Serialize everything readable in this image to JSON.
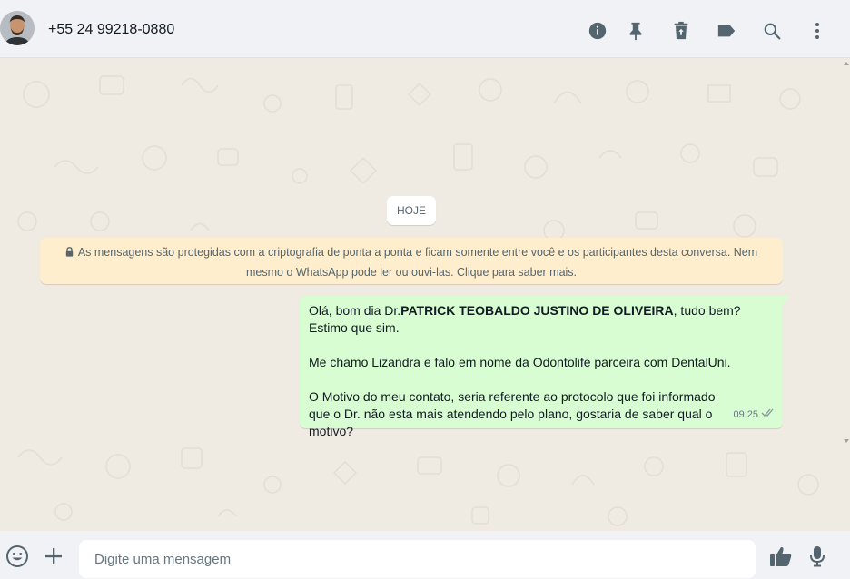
{
  "header": {
    "contact_name": "+55 24 99218-0880"
  },
  "chat": {
    "date_chip": "HOJE",
    "encryption_notice": "As mensagens são protegidas com a criptografia de ponta a ponta e ficam somente entre você e os participantes desta conversa. Nem mesmo o WhatsApp pode ler ou ouvi-las. Clique para saber mais.",
    "message": {
      "line1_prefix": "Olá, bom dia Dr.",
      "line1_bold": "PATRICK TEOBALDO JUSTINO DE OLIVEIRA",
      "line1_suffix": ", tudo bem? Estimo que sim.",
      "paragraph2": "Me chamo Lizandra e falo em nome da Odontolife parceira com DentalUni.",
      "paragraph3": "O Motivo do meu contato, seria referente ao protocolo que foi informado que o Dr. não esta mais atendendo pelo plano, gostaria de saber qual o motivo?",
      "time": "09:25"
    }
  },
  "footer": {
    "placeholder": "Digite uma mensagem"
  },
  "icons": {
    "info": "info-icon",
    "pin": "pin-icon",
    "delete": "trash-icon",
    "label": "label-icon",
    "search": "search-icon",
    "menu": "kebab-menu-icon",
    "emoji": "emoji-icon",
    "attach": "plus-icon",
    "like": "thumbs-up-icon",
    "mic": "microphone-icon"
  },
  "colors": {
    "outgoing_bubble": "#d9fdd3",
    "notice_bg": "#ffeecd",
    "icon": "#54656f"
  }
}
